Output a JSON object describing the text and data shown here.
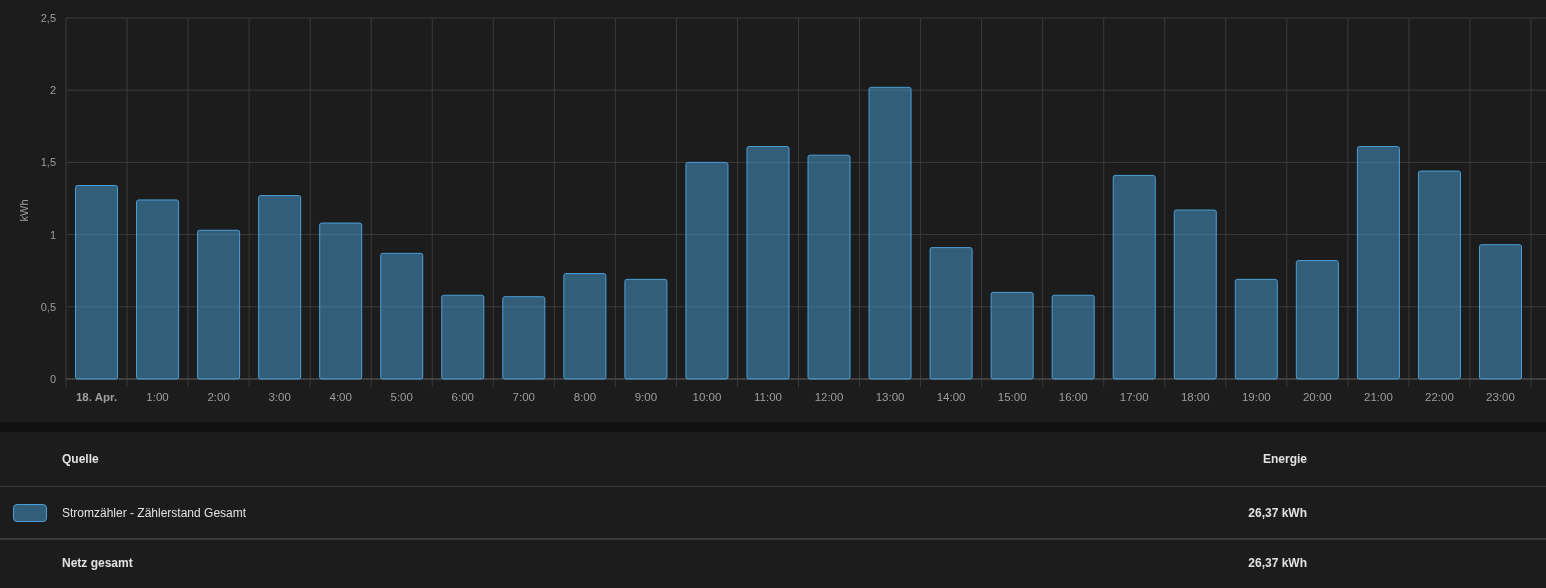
{
  "chart": {
    "chart_data": {
      "type": "bar",
      "ylabel": "kWh",
      "categories": [
        "18. Apr.",
        "1:00",
        "2:00",
        "3:00",
        "4:00",
        "5:00",
        "6:00",
        "7:00",
        "8:00",
        "9:00",
        "10:00",
        "11:00",
        "12:00",
        "13:00",
        "14:00",
        "15:00",
        "16:00",
        "17:00",
        "18:00",
        "19:00",
        "20:00",
        "21:00",
        "22:00",
        "23:00"
      ],
      "series": [
        {
          "color": "#4a9fd8",
          "values": [
            1.34,
            1.24,
            1.03,
            1.27,
            1.08,
            0.87,
            0.58,
            0.57,
            0.73,
            0.69,
            1.5,
            1.61,
            1.55,
            2.02,
            0.91,
            0.6,
            0.58,
            1.41,
            1.17,
            0.69,
            0.82,
            1.61,
            1.44,
            0.93
          ]
        }
      ],
      "ylim": [
        0,
        2.5
      ],
      "grid": true,
      "yticks": [
        {
          "value": 0,
          "label": "0"
        },
        {
          "value": 0.5,
          "label": "0,5"
        },
        {
          "value": 1,
          "label": "1"
        },
        {
          "value": 1.5,
          "label": "1,5"
        },
        {
          "value": 2,
          "label": "2"
        },
        {
          "value": 2.5,
          "label": "2,5"
        }
      ]
    }
  },
  "table": {
    "columns": [
      "Quelle",
      "Energie"
    ],
    "rows": [
      {
        "color": "#4a9fd8",
        "source": "Stromzähler - Zählerstand Gesamt",
        "energy": "26,37 kWh"
      }
    ],
    "total": {
      "label": "Netz gesamt",
      "energy": "26,37 kWh"
    }
  }
}
